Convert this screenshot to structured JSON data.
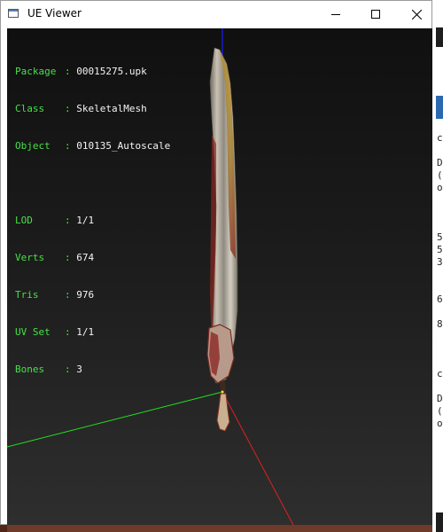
{
  "window": {
    "title": "UE Viewer",
    "controls": [
      "minimize",
      "maximize",
      "close"
    ]
  },
  "info_panel": {
    "asset_rows": [
      {
        "key": "Package",
        "sep": ": ",
        "value": "00015275.upk"
      },
      {
        "key": "Class",
        "sep": ": ",
        "value": "SkeletalMesh"
      },
      {
        "key": "Object",
        "sep": ": ",
        "value": "010135_Autoscale"
      }
    ],
    "stat_rows": [
      {
        "key": "LOD",
        "sep": ": ",
        "value": "1/1"
      },
      {
        "key": "Verts",
        "sep": ": ",
        "value": "674"
      },
      {
        "key": "Tris",
        "sep": ": ",
        "value": "976"
      },
      {
        "key": "UV Set",
        "sep": ": ",
        "value": "1/1"
      },
      {
        "key": "Bones",
        "sep": ": ",
        "value": "3"
      }
    ]
  },
  "axes": {
    "x_color": "#e02020",
    "y_color": "#20e020",
    "z_color": "#1a1aff"
  },
  "background_chars": [
    "c",
    "D",
    "(",
    "o",
    "5",
    "5",
    "3",
    "6",
    "8",
    "c",
    "D",
    "(",
    "o"
  ]
}
